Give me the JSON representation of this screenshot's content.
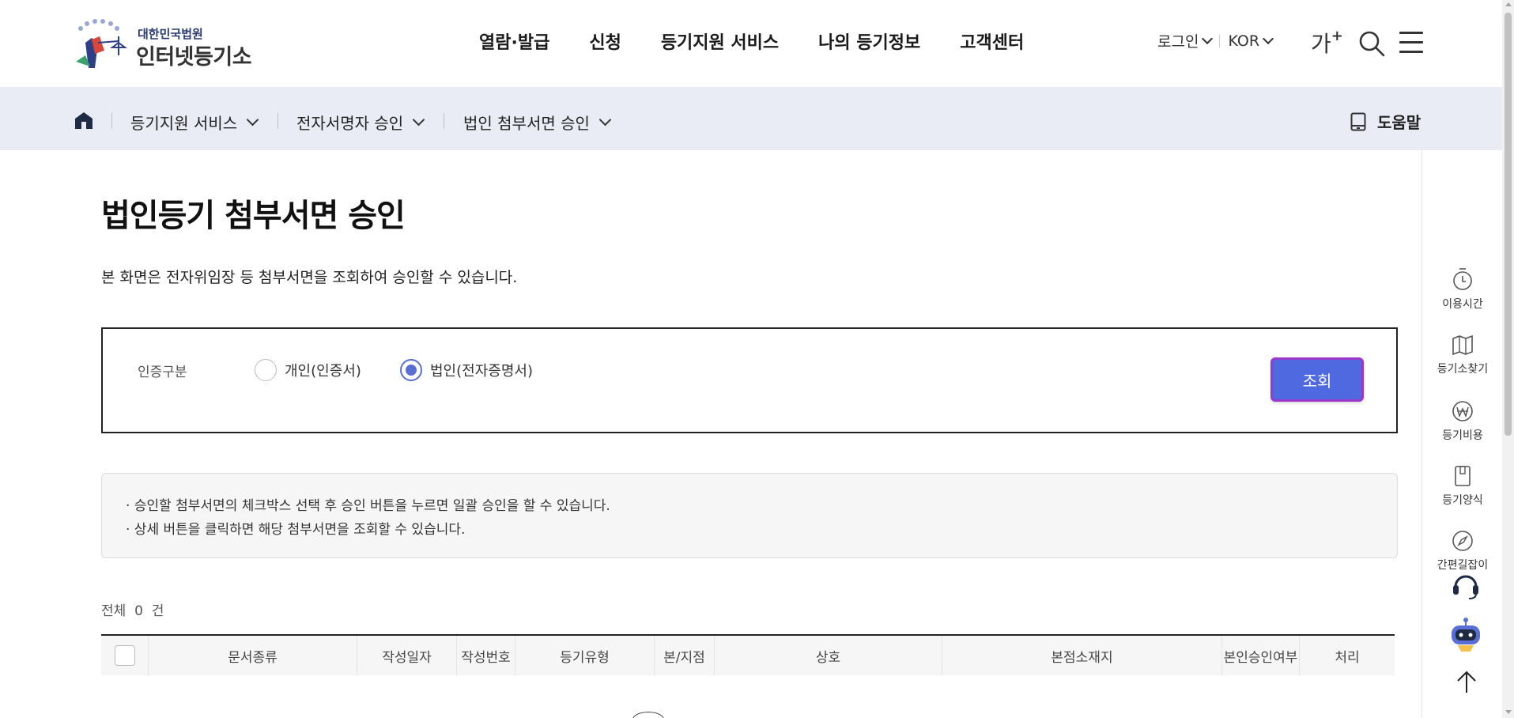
{
  "header": {
    "logo_small": "대한민국법원",
    "logo_big": "인터넷등기소",
    "nav": [
      "열람·발급",
      "신청",
      "등기지원 서비스",
      "나의 등기정보",
      "고객센터"
    ],
    "login_label": "로그인",
    "language_label": "KOR",
    "font_size_label": "가",
    "font_size_plus": "+"
  },
  "breadcrumb": {
    "items": [
      "등기지원 서비스",
      "전자서명자 승인",
      "법인 첨부서면 승인"
    ],
    "help_label": "도움말"
  },
  "page": {
    "title": "법인등기 첨부서면 승인",
    "description": "본 화면은 전자위임장 등 첨부서면을 조회하여 승인할 수 있습니다."
  },
  "search": {
    "label": "인증구분",
    "options": [
      {
        "label": "개인(인증서)",
        "selected": false
      },
      {
        "label": "법인(전자증명서)",
        "selected": true
      }
    ],
    "button_label": "조회"
  },
  "info": {
    "lines": [
      "· 승인할 첨부서면의 체크박스 선택 후 승인 버튼을 누르면 일괄 승인을 할 수 있습니다.",
      "· 상세 버튼을 클릭하면 해당 첨부서면을 조회할 수 있습니다."
    ]
  },
  "total": {
    "prefix": "전체",
    "count": "0",
    "suffix": "건"
  },
  "table": {
    "columns": [
      "문서종류",
      "작성일자",
      "작성번호",
      "등기유형",
      "본/지점",
      "상호",
      "본점소재지",
      "본인승인여부",
      "처리"
    ]
  },
  "quick_menu": {
    "items": [
      {
        "label": "이용시간",
        "icon": "clock-icon"
      },
      {
        "label": "등기소찾기",
        "icon": "map-icon"
      },
      {
        "label": "등기비용",
        "icon": "won-icon"
      },
      {
        "label": "등기양식",
        "icon": "document-icon"
      },
      {
        "label": "간편길잡이",
        "icon": "compass-icon"
      }
    ]
  },
  "colors": {
    "accent": "#4f6ae0",
    "focus_border": "#9b38c9",
    "breadcrumb_bg": "#e9ecf4",
    "radio_on": "#5a6fd6"
  }
}
